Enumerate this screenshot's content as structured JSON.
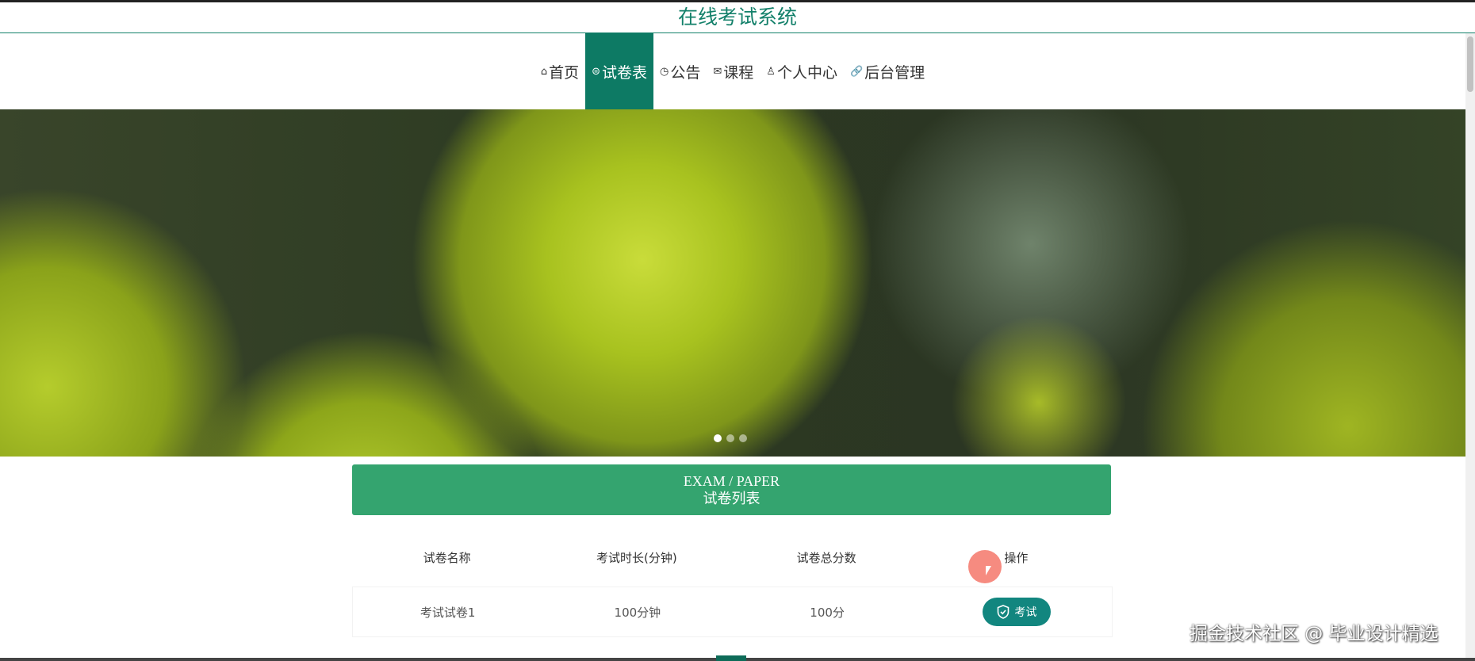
{
  "header": {
    "title": "在线考试系统"
  },
  "nav": {
    "items": [
      {
        "icon": "home-icon",
        "glyph": "⌂",
        "label": "首页"
      },
      {
        "icon": "paper-icon",
        "glyph": "⊜",
        "label": "试卷表",
        "active": true
      },
      {
        "icon": "clock-icon",
        "glyph": "◷",
        "label": "公告"
      },
      {
        "icon": "mail-icon",
        "glyph": "✉",
        "label": "课程"
      },
      {
        "icon": "user-icon",
        "glyph": "♙",
        "label": "个人中心"
      },
      {
        "icon": "link-icon",
        "glyph": "🔗",
        "label": "后台管理"
      }
    ]
  },
  "carousel": {
    "slides": 3,
    "active": 1
  },
  "section": {
    "title_en": "EXAM / PAPER",
    "title_zh": "试卷列表"
  },
  "table": {
    "headers": [
      "试卷名称",
      "考试时长(分钟)",
      "试卷总分数",
      "操作"
    ],
    "rows": [
      {
        "name": "考试试卷1",
        "duration": "100分钟",
        "score": "100分",
        "action": "考试"
      }
    ]
  },
  "watermark": "掘金技术社区 @ 毕业设计精选",
  "colors": {
    "brand": "#13806a",
    "panel": "#34a46f",
    "button": "#12867f"
  }
}
